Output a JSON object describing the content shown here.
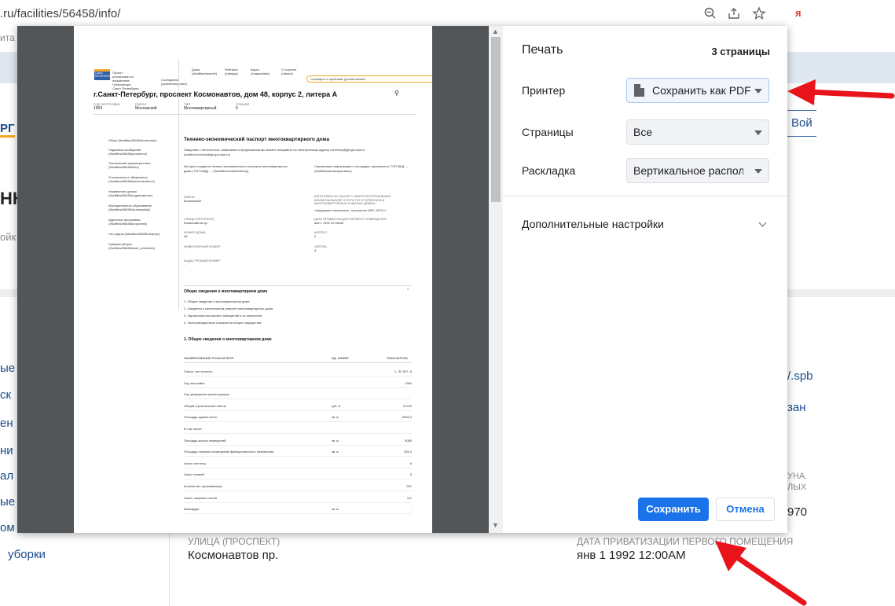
{
  "browser": {
    "url": ".ru/facilities/56458/info/",
    "ya_label": "я"
  },
  "background": {
    "frag_ita": "ита",
    "frag_rg": "РГ",
    "frag_nk": "НК",
    "frag_oy": "ойк",
    "frag_ye": "ые",
    "frag_sk": "ск",
    "frag_en": "ен",
    "frag_ni": "ни",
    "frag_al": "ал",
    "frag_ye2": "ые",
    "frag_om": "ом",
    "uborki": "уборки",
    "login": "Вой",
    "right_spb": "/.spb",
    "right_zan": "зан",
    "right_una": "УНА.",
    "right_lykh": "ЛЫХ",
    "right_970": "970",
    "street_label": "УЛИЦА (ПРОСПЕКТ)",
    "street_value": "Космонавтов пр.",
    "priv_label": "ДАТА ПРИВАТИЗАЦИИ ПЕРВОГО ПОМЕЩЕНИЯ",
    "priv_value": "янв 1 1992 12:00AM"
  },
  "preview": {
    "logo_line1": "Санкт-",
    "logo_line2": "ПЕТЕРБУРГ",
    "logo_caption": "Проект реализован по инициативе Губернатора Санкт-Петербурга",
    "nav": [
      "Сообщения (/problems/public/)",
      "Дома (/facilities/search/)",
      "Рейтинги (/ratings/)",
      "Карта (/maps/stats/)",
      "О портале (/about/)"
    ],
    "report_btn": "Сообщить о проблеме (/problems/add",
    "address": "г.Санкт-Петербург, проспект Космонавтов, дом 48, корпус 2, литера А",
    "meta": [
      {
        "label": "ГОД ПОСТРОЙКИ",
        "value": "1964"
      },
      {
        "label": "РАЙОН",
        "value": "Московский"
      },
      {
        "label": "ТИП",
        "value": "Многоквартирный"
      },
      {
        "label": "ЭТАЖЕЙ",
        "value": "5"
      }
    ],
    "sidebar_links": [
      "Обзор (/facilities/56458/summary/)",
      "Поданные сообщения (/facilities/56458/problems/)",
      "Техническая характеристика (/facilities/56458/info/)",
      "Отключения и объявления (/facilities/56458/disconnections/)",
      "Управление домом (/facilities/56458/organizations/)",
      "Муниципальное образование (/facilities/56458/municipality/)",
      "Адресные программы (/facilities/56458/programs/)",
      "Что рядом (/facilities/56458/nearby/)",
      "Графики уборки (/facilities/56458/work_schedule/)"
    ],
    "passport_title": "Технико-экономический паспорт многоквартирного дома",
    "passport_note": "Сведения о неточностях, замечания и предложения вы можете направить по электронному адресу correctep@gk.gov.spb.ru (mailto:correctep@gk.gov.spb.ru)",
    "history_link": "История создания технико-экономического паспорта многоквартирного дома (ТЭП МКД) → (/facilities/creationhistory)",
    "area_link": "Справочная информация о площадях, указанных в ТЭП МКД → (/facilities/areaexplanation)",
    "fields_left": [
      {
        "label": "РАЙОН",
        "value": "Московский"
      },
      {
        "label": "УЛИЦА (ПРОСПЕКТ)",
        "value": "Космонавтов пр."
      },
      {
        "label": "НОМЕР ДОМА",
        "value": "48"
      },
      {
        "label": "ИНВЕНТАРНЫЙ НОМЕР",
        "value": "-"
      },
      {
        "label": "КАДАСТРОВЫЙ НОМЕР",
        "value": "-"
      }
    ],
    "fields_right": [
      {
        "label": "КАТЕГОРИЯ ПО РАСЧЕТУ ЭНЕРГОПОТРЕБЛЕНИЯ КОММУНАЛЬНОЙ УСЛУГИ ПО ОТОПЛЕНИЮ В МНОГОКВАРТИРНЫХ И ЖИЛЫХ ДОМАХ",
        "value": "«Хрущевки» панельные, построены 1957-1970 г.г."
      },
      {
        "label": "ДАТА ПРИВАТИЗАЦИИ ПЕРВОГО ПОМЕЩЕНИЯ",
        "value": "янв 1 1992 12:00AM"
      },
      {
        "label": "КОРПУС",
        "value": "2"
      },
      {
        "label": "ЛИТЕРА",
        "value": "А"
      }
    ],
    "general_title": "Общие сведения о многоквартирном доме",
    "general_list": [
      "1. Общие сведения о многоквартирном доме",
      "2. Сведения о капитальном ремонте многоквартирного дома",
      "3. Характеристика жилых помещений и их заселения",
      "4. Эксплуатационные показатели общего имущества"
    ],
    "section1_title": "1. Общие сведения о многоквартирном доме",
    "table_headers": [
      "НАИМЕНОВАНИЕ ПОКАЗАТЕЛЯ",
      "ЕД. ИЗМЕР.",
      "ПОКАЗАТЕЛЬ"
    ],
    "table_rows": [
      {
        "name": "Серия, тип проекта",
        "unit": "",
        "value": "1- ЛГ-507- 6"
      },
      {
        "name": "Год постройки",
        "unit": "",
        "value": "1964"
      },
      {
        "name": "Год проведения реконструкции",
        "unit": "",
        "value": "-"
      },
      {
        "name": "Общий строительный объем",
        "unit": "куб. м",
        "value": "21700"
      },
      {
        "name": "Площадь здания всего",
        "unit": "кв. м",
        "value": "5906,4"
      },
      {
        "name": "В том числе:",
        "unit": "",
        "value": ""
      },
      {
        "name": "Площадь жилых помещений",
        "unit": "кв. м",
        "value": "5065"
      },
      {
        "name": "Площадь нежилых помещений функционального назначения",
        "unit": "кв. м",
        "value": "333,4"
      },
      {
        "name": "Число лестниц",
        "unit": "",
        "value": "6"
      },
      {
        "name": "Число этажей",
        "unit": "",
        "value": "5"
      },
      {
        "name": "Количество проживающих",
        "unit": "",
        "value": "257"
      },
      {
        "name": "Число лицевых счетов",
        "unit": "",
        "value": "111"
      },
      {
        "name": "Мансарды",
        "unit": "кв. м",
        "value": "-"
      }
    ]
  },
  "print": {
    "title": "Печать",
    "pages_count": "3 страницы",
    "printer_label": "Принтер",
    "printer_value": "Сохранить как PDF",
    "pages_label": "Страницы",
    "pages_value": "Все",
    "layout_label": "Раскладка",
    "layout_value": "Вертикальное расположение",
    "more_settings": "Дополнительные настройки",
    "save": "Сохранить",
    "cancel": "Отмена"
  },
  "icons": [
    "zoom-icon",
    "share-icon",
    "star-icon",
    "pdf-file-icon",
    "chevron-down-icon",
    "search-icon"
  ],
  "colors": {
    "accent": "#1a73e8",
    "arrow_red": "#e8131b",
    "preview_bg": "#525659"
  }
}
